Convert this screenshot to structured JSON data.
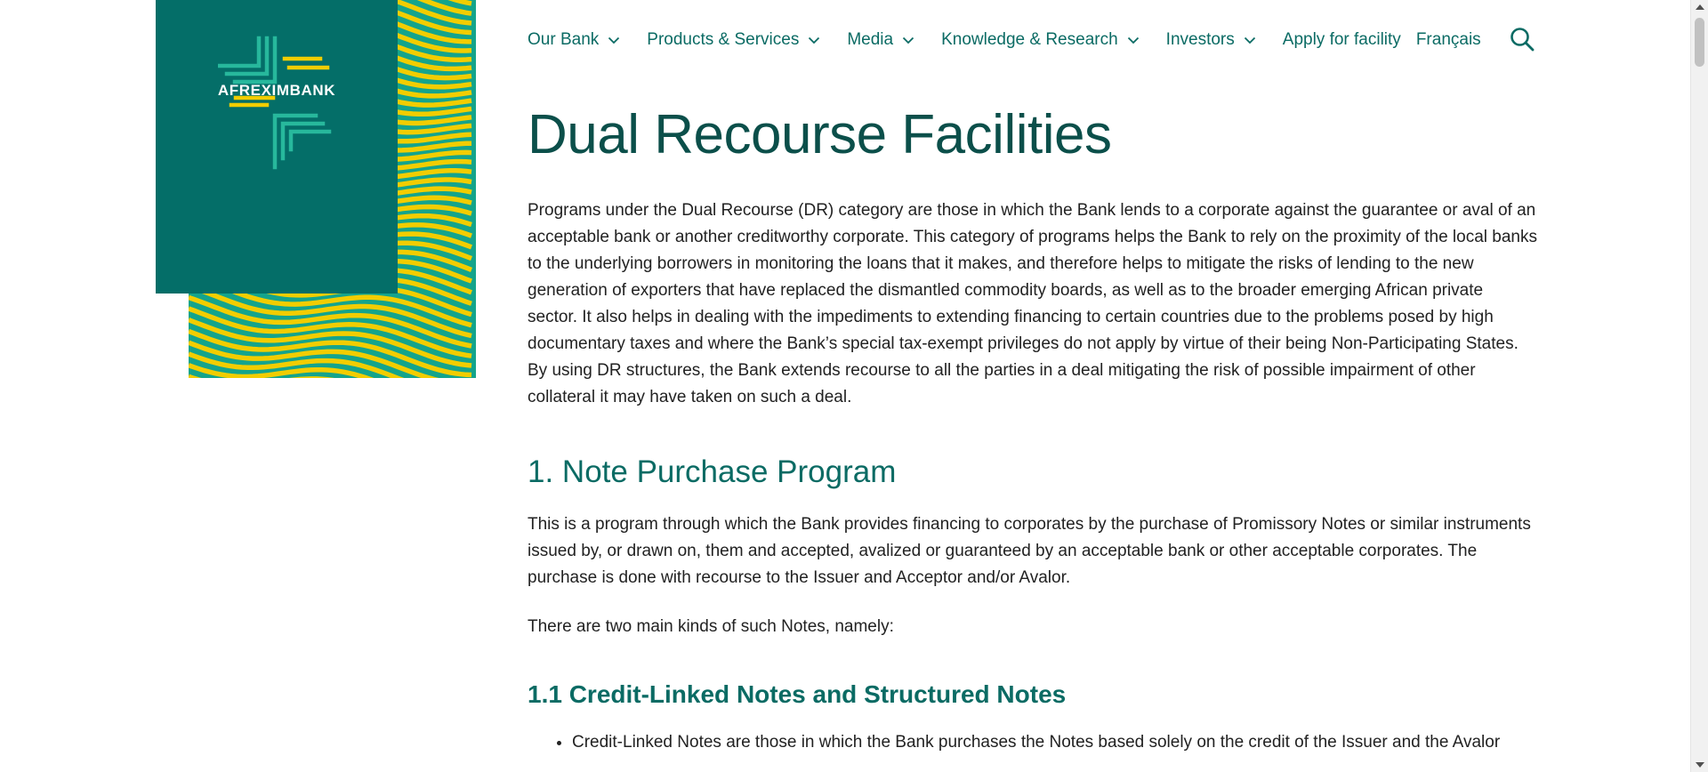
{
  "brand": {
    "logo_text": "AFREXIMBANK",
    "colors": {
      "teal": "#046e68",
      "yellow": "#f2cd00",
      "green": "#14a48c",
      "text_teal": "#0b6b64"
    }
  },
  "nav": {
    "items": [
      {
        "label": "Our Bank",
        "dropdown": true
      },
      {
        "label": "Products & Services",
        "dropdown": true
      },
      {
        "label": "Media",
        "dropdown": true
      },
      {
        "label": "Knowledge & Research",
        "dropdown": true
      },
      {
        "label": "Investors",
        "dropdown": true
      },
      {
        "label": "Apply for facility",
        "dropdown": false
      },
      {
        "label": "Français",
        "dropdown": false
      }
    ],
    "search_icon": "search-icon"
  },
  "page": {
    "title": "Dual Recourse Facilities",
    "intro": "Programs under the Dual Recourse (DR) category are those in which the Bank lends to a corporate against the guarantee or aval of an acceptable bank or another creditworthy corporate. This category of programs helps the Bank to rely on the proximity of the local banks to the underlying borrowers in monitoring the loans that it makes, and therefore helps to mitigate the risks of lending to the new generation of exporters that have replaced the dismantled commodity boards, as well as to the broader emerging African private sector. It also helps in dealing with the impediments to extending financing to certain countries due to the problems posed by high documentary taxes and where the Bank’s special tax-exempt privileges do not apply by virtue of their being Non-Participating States. By using DR structures, the Bank extends recourse to all the parties in a deal mitigating the risk of possible impairment of other collateral it may have taken on such a deal.",
    "section1_heading": "1. Note Purchase Program",
    "section1_para": "This is a program through which the Bank provides financing to corporates by the purchase of Promissory Notes or similar instruments issued by, or drawn on, them and accepted, avalized or guaranteed by an acceptable bank or other acceptable corporates. The purchase is done with recourse to the Issuer and Acceptor and/or Avalor.",
    "section1_para2": "There are two main kinds of such Notes, namely:",
    "section11_heading": "1.1 Credit-Linked Notes and Structured Notes",
    "bullets": [
      "Credit-Linked Notes are those in which the Bank purchases the Notes based solely on the credit of the Issuer and the Avalor"
    ]
  }
}
